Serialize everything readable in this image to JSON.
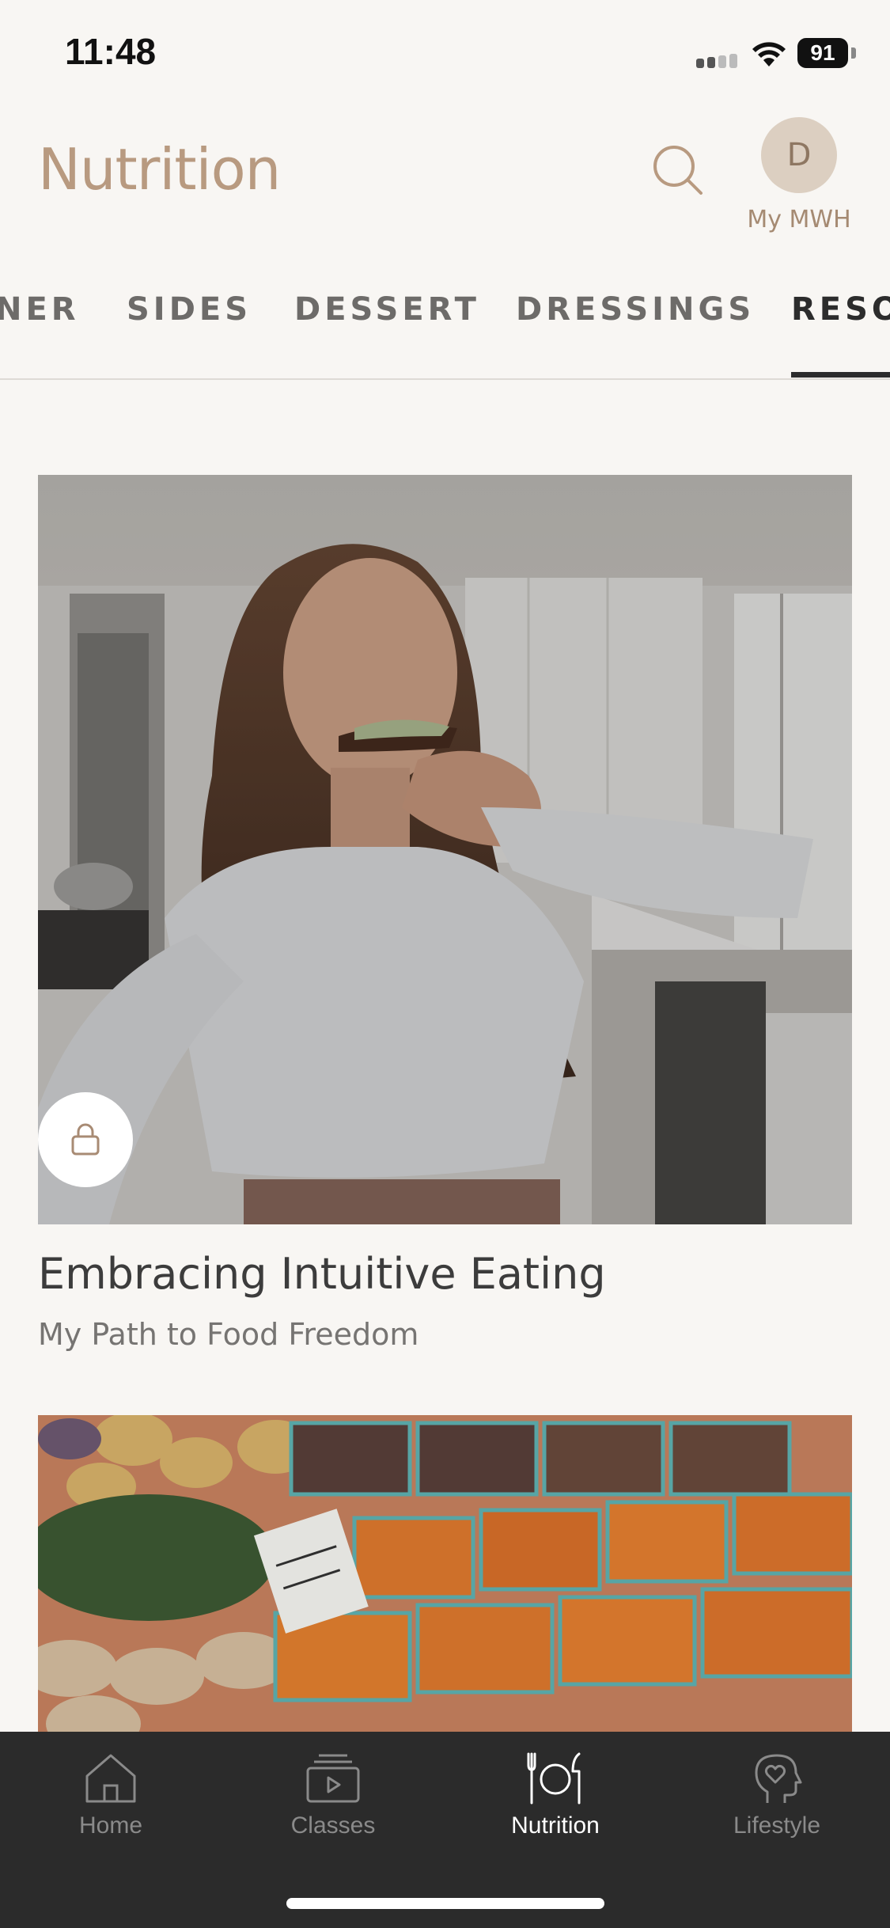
{
  "status": {
    "time": "11:48",
    "battery": "91"
  },
  "header": {
    "title": "Nutrition",
    "avatar_initial": "D",
    "avatar_label": "My MWH"
  },
  "tabs": [
    {
      "label": "NER"
    },
    {
      "label": "SIDES"
    },
    {
      "label": "DESSERT"
    },
    {
      "label": "DRESSINGS"
    },
    {
      "label": "RESO",
      "active": true
    }
  ],
  "cards": [
    {
      "title": "Embracing Intuitive Eating",
      "subtitle": "My Path to Food Freedom",
      "locked": true,
      "image_subject": "woman eating toast in kitchen"
    },
    {
      "image_subject": "farmers market tomatoes and squash"
    }
  ],
  "bottom_nav": [
    {
      "label": "Home",
      "icon": "home-icon"
    },
    {
      "label": "Classes",
      "icon": "classes-icon"
    },
    {
      "label": "Nutrition",
      "icon": "plate-icon",
      "active": true
    },
    {
      "label": "Lifestyle",
      "icon": "head-heart-icon"
    }
  ],
  "colors": {
    "background": "#f8f6f3",
    "accent": "#b89a80",
    "nav_background": "#2b2b2b"
  }
}
